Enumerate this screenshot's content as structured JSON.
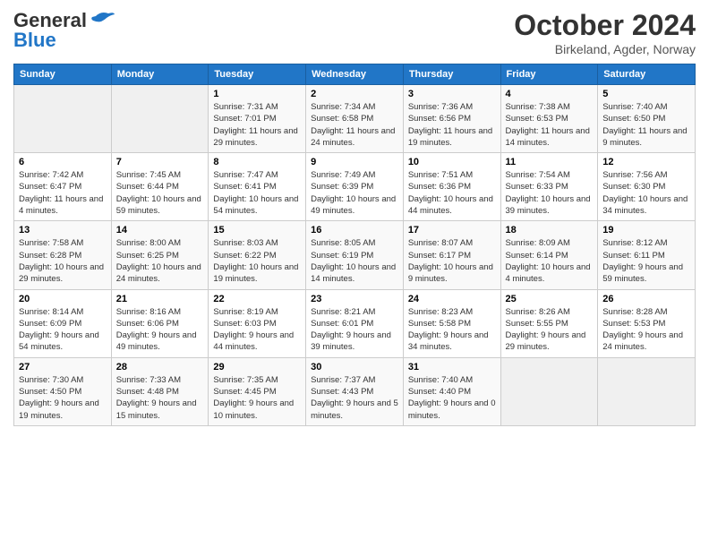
{
  "header": {
    "logo_general": "General",
    "logo_blue": "Blue",
    "month_title": "October 2024",
    "location": "Birkeland, Agder, Norway"
  },
  "days_of_week": [
    "Sunday",
    "Monday",
    "Tuesday",
    "Wednesday",
    "Thursday",
    "Friday",
    "Saturday"
  ],
  "weeks": [
    [
      {
        "day": "",
        "sunrise": "",
        "sunset": "",
        "daylight": ""
      },
      {
        "day": "",
        "sunrise": "",
        "sunset": "",
        "daylight": ""
      },
      {
        "day": "1",
        "sunrise": "Sunrise: 7:31 AM",
        "sunset": "Sunset: 7:01 PM",
        "daylight": "Daylight: 11 hours and 29 minutes."
      },
      {
        "day": "2",
        "sunrise": "Sunrise: 7:34 AM",
        "sunset": "Sunset: 6:58 PM",
        "daylight": "Daylight: 11 hours and 24 minutes."
      },
      {
        "day": "3",
        "sunrise": "Sunrise: 7:36 AM",
        "sunset": "Sunset: 6:56 PM",
        "daylight": "Daylight: 11 hours and 19 minutes."
      },
      {
        "day": "4",
        "sunrise": "Sunrise: 7:38 AM",
        "sunset": "Sunset: 6:53 PM",
        "daylight": "Daylight: 11 hours and 14 minutes."
      },
      {
        "day": "5",
        "sunrise": "Sunrise: 7:40 AM",
        "sunset": "Sunset: 6:50 PM",
        "daylight": "Daylight: 11 hours and 9 minutes."
      }
    ],
    [
      {
        "day": "6",
        "sunrise": "Sunrise: 7:42 AM",
        "sunset": "Sunset: 6:47 PM",
        "daylight": "Daylight: 11 hours and 4 minutes."
      },
      {
        "day": "7",
        "sunrise": "Sunrise: 7:45 AM",
        "sunset": "Sunset: 6:44 PM",
        "daylight": "Daylight: 10 hours and 59 minutes."
      },
      {
        "day": "8",
        "sunrise": "Sunrise: 7:47 AM",
        "sunset": "Sunset: 6:41 PM",
        "daylight": "Daylight: 10 hours and 54 minutes."
      },
      {
        "day": "9",
        "sunrise": "Sunrise: 7:49 AM",
        "sunset": "Sunset: 6:39 PM",
        "daylight": "Daylight: 10 hours and 49 minutes."
      },
      {
        "day": "10",
        "sunrise": "Sunrise: 7:51 AM",
        "sunset": "Sunset: 6:36 PM",
        "daylight": "Daylight: 10 hours and 44 minutes."
      },
      {
        "day": "11",
        "sunrise": "Sunrise: 7:54 AM",
        "sunset": "Sunset: 6:33 PM",
        "daylight": "Daylight: 10 hours and 39 minutes."
      },
      {
        "day": "12",
        "sunrise": "Sunrise: 7:56 AM",
        "sunset": "Sunset: 6:30 PM",
        "daylight": "Daylight: 10 hours and 34 minutes."
      }
    ],
    [
      {
        "day": "13",
        "sunrise": "Sunrise: 7:58 AM",
        "sunset": "Sunset: 6:28 PM",
        "daylight": "Daylight: 10 hours and 29 minutes."
      },
      {
        "day": "14",
        "sunrise": "Sunrise: 8:00 AM",
        "sunset": "Sunset: 6:25 PM",
        "daylight": "Daylight: 10 hours and 24 minutes."
      },
      {
        "day": "15",
        "sunrise": "Sunrise: 8:03 AM",
        "sunset": "Sunset: 6:22 PM",
        "daylight": "Daylight: 10 hours and 19 minutes."
      },
      {
        "day": "16",
        "sunrise": "Sunrise: 8:05 AM",
        "sunset": "Sunset: 6:19 PM",
        "daylight": "Daylight: 10 hours and 14 minutes."
      },
      {
        "day": "17",
        "sunrise": "Sunrise: 8:07 AM",
        "sunset": "Sunset: 6:17 PM",
        "daylight": "Daylight: 10 hours and 9 minutes."
      },
      {
        "day": "18",
        "sunrise": "Sunrise: 8:09 AM",
        "sunset": "Sunset: 6:14 PM",
        "daylight": "Daylight: 10 hours and 4 minutes."
      },
      {
        "day": "19",
        "sunrise": "Sunrise: 8:12 AM",
        "sunset": "Sunset: 6:11 PM",
        "daylight": "Daylight: 9 hours and 59 minutes."
      }
    ],
    [
      {
        "day": "20",
        "sunrise": "Sunrise: 8:14 AM",
        "sunset": "Sunset: 6:09 PM",
        "daylight": "Daylight: 9 hours and 54 minutes."
      },
      {
        "day": "21",
        "sunrise": "Sunrise: 8:16 AM",
        "sunset": "Sunset: 6:06 PM",
        "daylight": "Daylight: 9 hours and 49 minutes."
      },
      {
        "day": "22",
        "sunrise": "Sunrise: 8:19 AM",
        "sunset": "Sunset: 6:03 PM",
        "daylight": "Daylight: 9 hours and 44 minutes."
      },
      {
        "day": "23",
        "sunrise": "Sunrise: 8:21 AM",
        "sunset": "Sunset: 6:01 PM",
        "daylight": "Daylight: 9 hours and 39 minutes."
      },
      {
        "day": "24",
        "sunrise": "Sunrise: 8:23 AM",
        "sunset": "Sunset: 5:58 PM",
        "daylight": "Daylight: 9 hours and 34 minutes."
      },
      {
        "day": "25",
        "sunrise": "Sunrise: 8:26 AM",
        "sunset": "Sunset: 5:55 PM",
        "daylight": "Daylight: 9 hours and 29 minutes."
      },
      {
        "day": "26",
        "sunrise": "Sunrise: 8:28 AM",
        "sunset": "Sunset: 5:53 PM",
        "daylight": "Daylight: 9 hours and 24 minutes."
      }
    ],
    [
      {
        "day": "27",
        "sunrise": "Sunrise: 7:30 AM",
        "sunset": "Sunset: 4:50 PM",
        "daylight": "Daylight: 9 hours and 19 minutes."
      },
      {
        "day": "28",
        "sunrise": "Sunrise: 7:33 AM",
        "sunset": "Sunset: 4:48 PM",
        "daylight": "Daylight: 9 hours and 15 minutes."
      },
      {
        "day": "29",
        "sunrise": "Sunrise: 7:35 AM",
        "sunset": "Sunset: 4:45 PM",
        "daylight": "Daylight: 9 hours and 10 minutes."
      },
      {
        "day": "30",
        "sunrise": "Sunrise: 7:37 AM",
        "sunset": "Sunset: 4:43 PM",
        "daylight": "Daylight: 9 hours and 5 minutes."
      },
      {
        "day": "31",
        "sunrise": "Sunrise: 7:40 AM",
        "sunset": "Sunset: 4:40 PM",
        "daylight": "Daylight: 9 hours and 0 minutes."
      },
      {
        "day": "",
        "sunrise": "",
        "sunset": "",
        "daylight": ""
      },
      {
        "day": "",
        "sunrise": "",
        "sunset": "",
        "daylight": ""
      }
    ]
  ]
}
